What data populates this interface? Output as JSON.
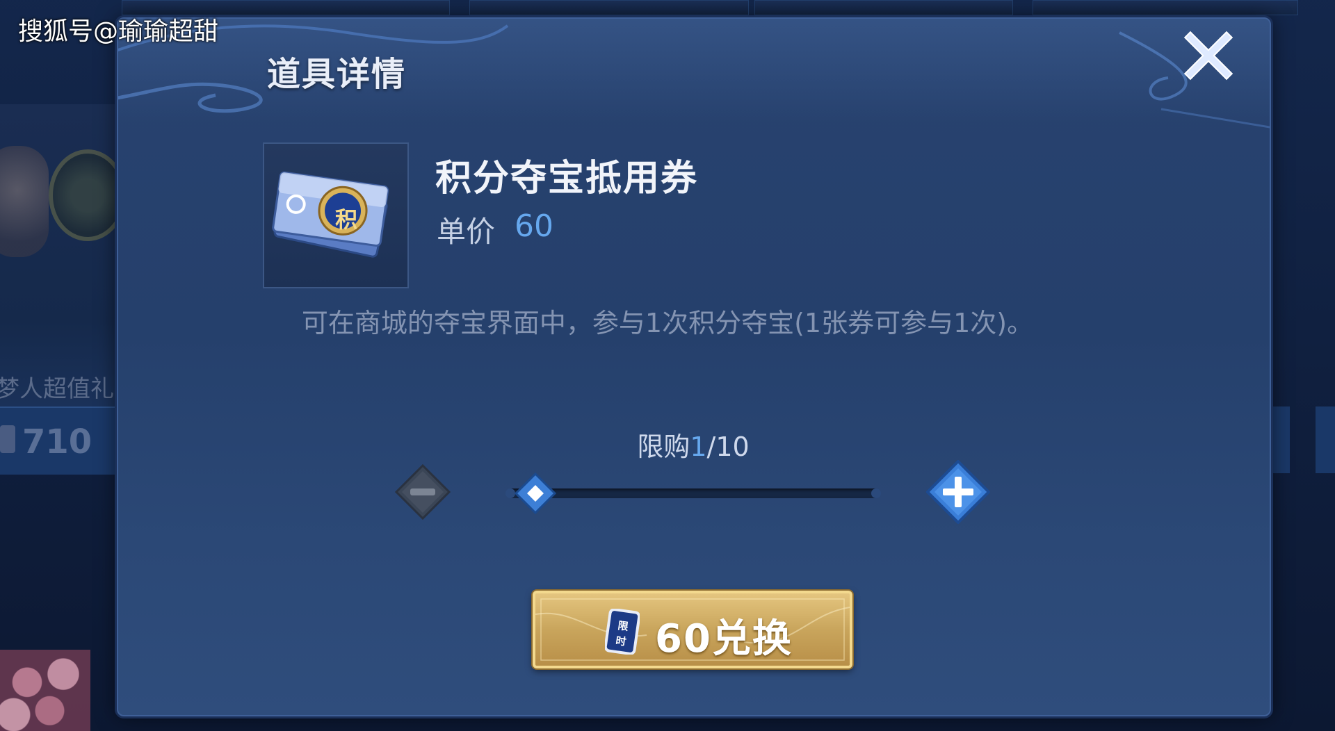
{
  "watermark": "搜狐号@瑜瑜超甜",
  "background": {
    "bundle_label": "梦人超值礼",
    "bundle_price": "710"
  },
  "dialog": {
    "title": "道具详情",
    "close_icon": "close-icon"
  },
  "item": {
    "name": "积分夺宝抵用券",
    "price_label": "单价",
    "price_value": "60",
    "icon": "voucher-ticket-icon",
    "icon_glyph": "积",
    "description": "可在商城的夺宝界面中，参与1次积分夺宝(1张券可参与1次)。"
  },
  "quantity": {
    "limit_label": "限购",
    "current": "1",
    "separator_max": "/10",
    "value_fraction": 0.1
  },
  "exchange": {
    "ticket_glyph": "限时",
    "label": "60兑换"
  },
  "colors": {
    "accent_blue": "#66a8ee",
    "gold": "#c9a55c"
  }
}
